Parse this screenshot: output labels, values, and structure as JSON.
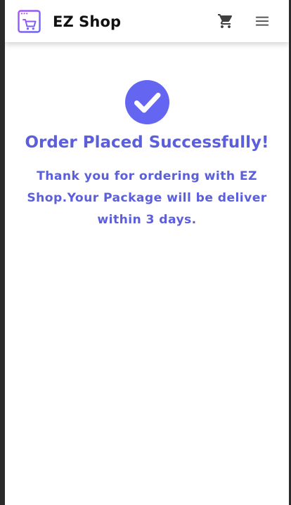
{
  "colors": {
    "accent": "#5b5fdb",
    "check_circle": "#6466f1",
    "logo_gradient_start": "#a855f7",
    "logo_gradient_end": "#6366f1",
    "nav_icon": "#4a4a4a"
  },
  "navbar": {
    "brand_name": "EZ Shop",
    "logo_icon": "shop-cart-window-icon",
    "cart_icon": "shopping-cart-icon",
    "menu_icon": "hamburger-menu-icon"
  },
  "confirmation": {
    "icon": "check-circle-icon",
    "title": "Order Placed Successfully!",
    "message": "Thank you for ordering with EZ Shop.Your Package will be deliver within 3 days."
  }
}
